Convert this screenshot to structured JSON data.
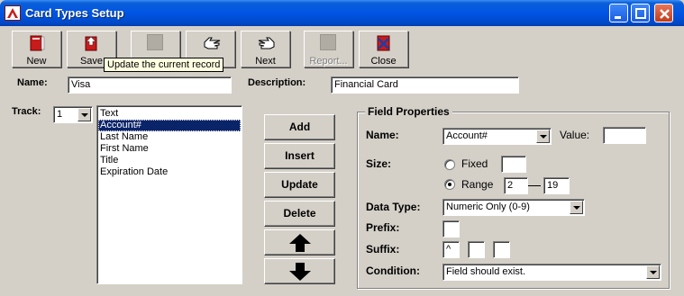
{
  "window": {
    "title": "Card Types Setup"
  },
  "toolbar": {
    "new_label": "New",
    "save_label": "Save",
    "blank_label": "",
    "prev_label": "",
    "next_label": "Next",
    "report_label": "Report...",
    "close_label": "Close",
    "tooltip": "Update the current record"
  },
  "form": {
    "name_label": "Name:",
    "name_value": "Visa",
    "description_label": "Description:",
    "description_value": "Financial Card",
    "track_label": "Track:",
    "track_value": "1"
  },
  "fields_list": [
    "Text",
    "Account#",
    "Last Name",
    "First Name",
    "Title",
    "Expiration Date"
  ],
  "fields_selected_index": 1,
  "actions": {
    "add": "Add",
    "insert": "Insert",
    "update": "Update",
    "delete": "Delete"
  },
  "field_properties": {
    "title": "Field Properties",
    "name_label": "Name:",
    "name_value": "Account#",
    "value_label": "Value:",
    "value_value": "",
    "size_label": "Size:",
    "fixed_label": "Fixed",
    "fixed_value": "",
    "range_label": "Range",
    "range_from": "2",
    "range_to": "19",
    "size_mode": "Range",
    "data_type_label": "Data Type:",
    "data_type_value": "Numeric Only (0-9)",
    "prefix_label": "Prefix:",
    "prefix_value": "",
    "suffix_label": "Suffix:",
    "suffix_1": "^",
    "suffix_2": "",
    "suffix_3": "",
    "condition_label": "Condition:",
    "condition_value": "Field should exist."
  },
  "colors": {
    "selection": "#0a246a",
    "titlebar": "#0054e3",
    "face": "#d4d0c8"
  }
}
